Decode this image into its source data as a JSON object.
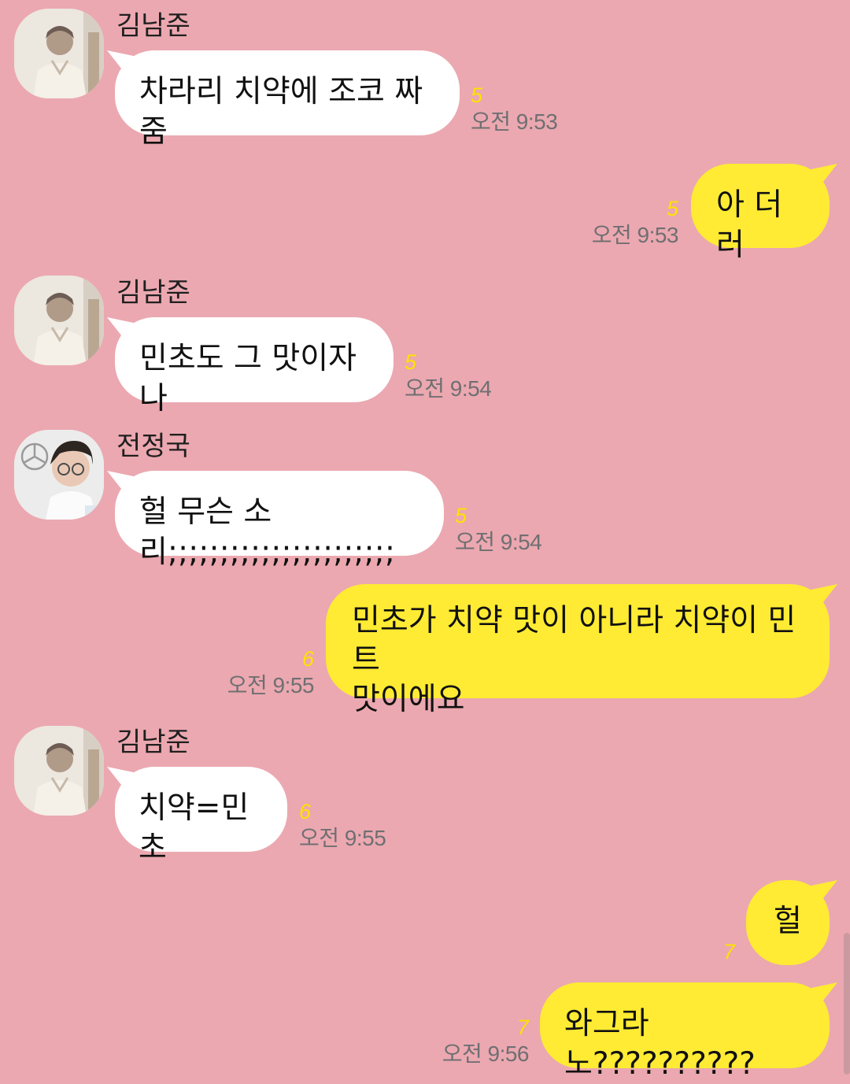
{
  "chat": {
    "participants": [
      {
        "name": "김남준"
      },
      {
        "name": "전정국"
      }
    ],
    "messages": [
      {
        "sender": "김남준",
        "text": "차라리 치약에 조코 짜줌",
        "read_count": "5",
        "time": "오전 9:53",
        "direction": "incoming"
      },
      {
        "sender": "",
        "text": "아 더러",
        "read_count": "5",
        "time": "오전 9:53",
        "direction": "outgoing"
      },
      {
        "sender": "김남준",
        "text": "민초도 그 맛이자나",
        "read_count": "5",
        "time": "오전 9:54",
        "direction": "incoming"
      },
      {
        "sender": "전정국",
        "text": "헐 무슨 소리;;;;;;;;;;;;;;;;;;;;;;",
        "read_count": "5",
        "time": "오전 9:54",
        "direction": "incoming"
      },
      {
        "sender": "",
        "text": "민초가 치약 맛이 아니라 치약이 민트\n맛이에요",
        "read_count": "6",
        "time": "오전 9:55",
        "direction": "outgoing"
      },
      {
        "sender": "김남준",
        "text": "치약=민초",
        "read_count": "6",
        "time": "오전 9:55",
        "direction": "incoming"
      },
      {
        "sender": "",
        "text": "헐",
        "read_count": "7",
        "time": "",
        "direction": "outgoing"
      },
      {
        "sender": "",
        "text": "와그라노??????????",
        "read_count": "7",
        "time": "오전 9:56",
        "direction": "outgoing"
      }
    ]
  },
  "colors": {
    "background": "#eba8b0",
    "incoming_bubble": "#ffffff",
    "outgoing_bubble": "#ffeb33",
    "read_count": "#ffe100",
    "timestamp": "#6f6f72"
  },
  "icons": {
    "avatar_namjoon": "profile-photo",
    "avatar_jungkook": "profile-photo"
  }
}
